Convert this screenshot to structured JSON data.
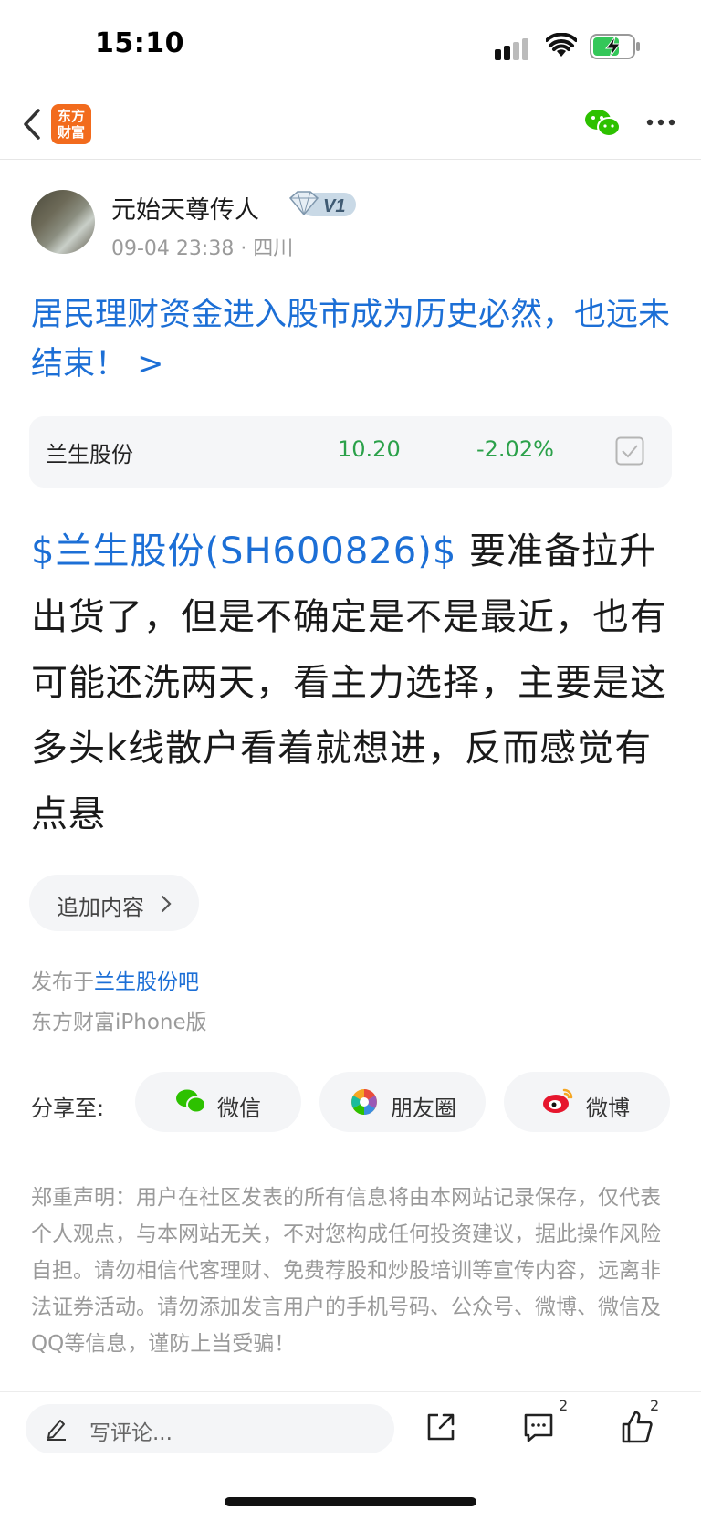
{
  "status_bar": {
    "time": "15:10"
  },
  "nav": {
    "logo_line1": "东方",
    "logo_line2": "财富"
  },
  "author": {
    "name": "元始天尊传人",
    "badge": "V1",
    "meta": "09-04 23:38 · 四川"
  },
  "post": {
    "title": "居民理财资金进入股市成为历史必然，也远未结束！ >",
    "stock_link": "$兰生股份(SH600826)$",
    "body_text": " 要准备拉升出货了，但是不确定是不是最近，也有可能还洗两天，看主力选择，主要是这多头k线散户看着就想进，反而感觉有点悬"
  },
  "stock_card": {
    "name": "兰生股份",
    "price": "10.20",
    "change": "-2.02%",
    "color": "#2ba14a"
  },
  "actions": {
    "add_content": "追加内容"
  },
  "publish": {
    "prefix": "发布于",
    "bar_name": "兰生股份吧",
    "client": "东方财富iPhone版"
  },
  "share": {
    "label": "分享至:",
    "wechat": "微信",
    "moments": "朋友圈",
    "weibo": "微博"
  },
  "disclaimer": "郑重声明：用户在社区发表的所有信息将由本网站记录保存，仅代表个人观点，与本网站无关，不对您构成任何投资建议，据此操作风险自担。请勿相信代客理财、免费荐股和炒股培训等宣传内容，远离非法证券活动。请勿添加发言用户的手机号码、公众号、微博、微信及QQ等信息，谨防上当受骗！",
  "bottom_bar": {
    "comment_placeholder": "写评论...",
    "comment_count": "2",
    "like_count": "2"
  },
  "colors": {
    "link_blue": "#1c6fd6",
    "brand_orange": "#f26b1d",
    "down_green": "#2ba14a"
  }
}
